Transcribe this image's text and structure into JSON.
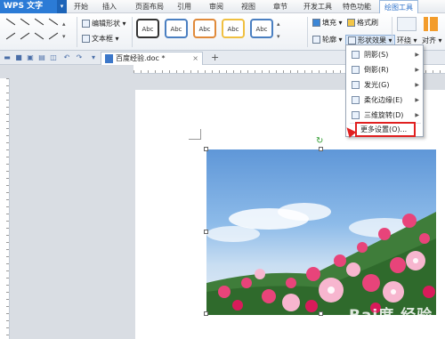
{
  "menubar": {
    "app_label": "WPS 文字",
    "tabs": [
      "开始",
      "插入",
      "页面布局",
      "引用",
      "审阅",
      "视图",
      "章节",
      "开发工具",
      "特色功能",
      "绘图工具"
    ]
  },
  "ribbon": {
    "edit_shape": "编辑形状",
    "text_box": "文本框",
    "style_samples": [
      "Abc",
      "Abc",
      "Abc",
      "Abc",
      "Abc"
    ],
    "fill": "填充",
    "format_brush": "格式刷",
    "outline": "轮廓",
    "shape_effects": "形状效果",
    "wrap": "环绕",
    "align": "对齐"
  },
  "docbar": {
    "doc_tab": "百度经验.doc *"
  },
  "dropdown": {
    "items": [
      "阴影(S)",
      "倒影(R)",
      "发光(G)",
      "柔化边缘(E)",
      "三维旋转(D)"
    ],
    "more": "更多设置(O)..."
  },
  "watermark": "Bai度 经验",
  "colors": {
    "accent": "#2b7bd6",
    "highlight_red": "#e02020",
    "style_borders": [
      "#333333",
      "#4a7fc1",
      "#e08a3a",
      "#f0c040",
      "#4a7fc1"
    ]
  }
}
